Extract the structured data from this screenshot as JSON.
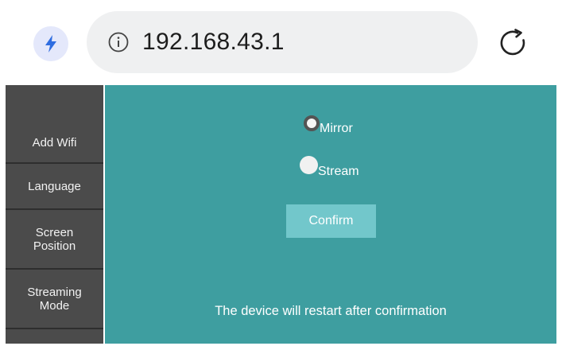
{
  "browser": {
    "url": "192.168.43.1",
    "icons": {
      "left": "lightning-bolt-icon",
      "info": "info-icon",
      "reload": "reload-icon"
    },
    "accent": "#2f6de0"
  },
  "sidebar": {
    "items": [
      {
        "label": "Add Wifi"
      },
      {
        "label": "Language"
      },
      {
        "label": "Screen\nPosition"
      },
      {
        "label": "Streaming\nMode"
      }
    ]
  },
  "main": {
    "options": [
      {
        "label": "Mirror",
        "selected": true
      },
      {
        "label": "Stream",
        "selected": false
      }
    ],
    "confirm_label": "Confirm",
    "notice": "The device will restart after confirmation",
    "background_color": "#3e9ea0",
    "button_color": "#72c7cb"
  }
}
